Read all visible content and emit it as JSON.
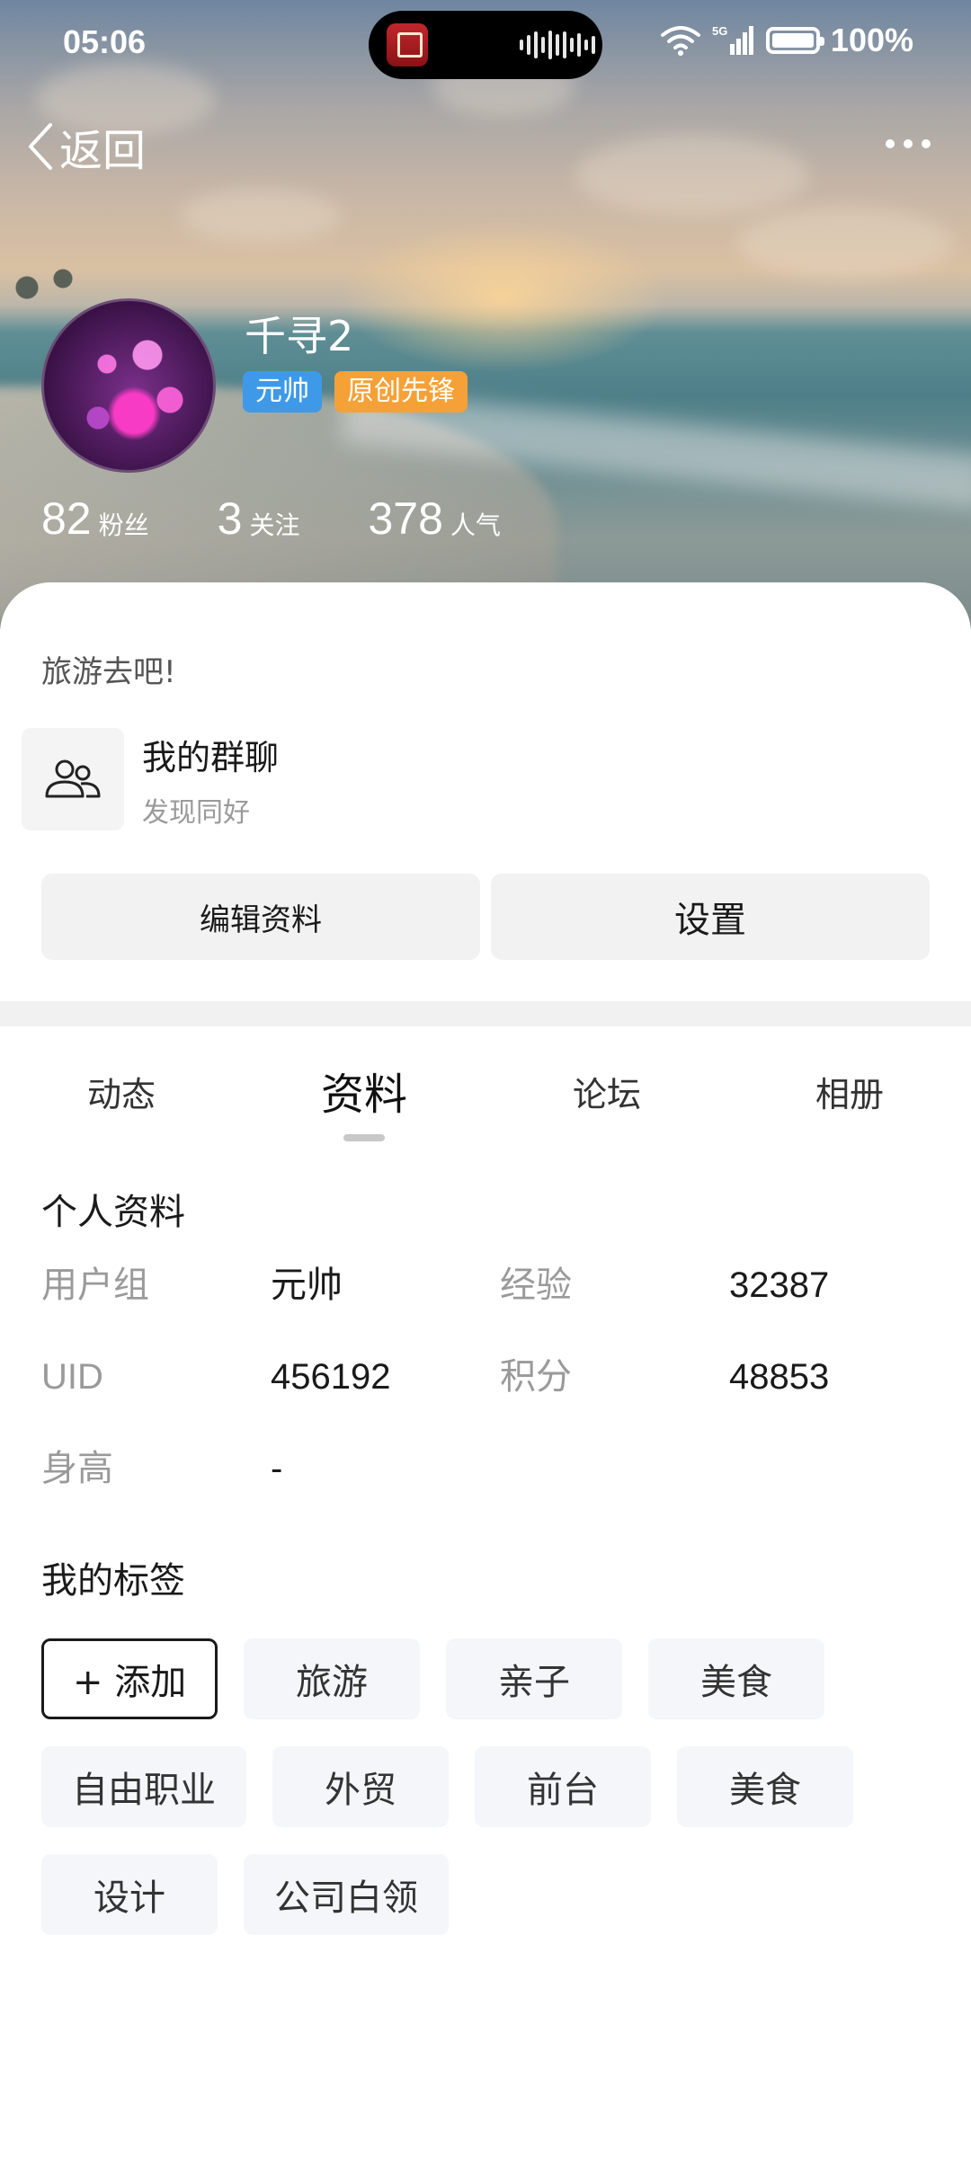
{
  "status_bar": {
    "time": "05:06",
    "network_type": "5G",
    "battery": "100%",
    "icons": [
      "wifi-icon",
      "signal-icon",
      "battery-icon"
    ]
  },
  "nav": {
    "back_label": "返回",
    "more_icon": "more-dots-icon"
  },
  "profile": {
    "username": "千寻2",
    "badges": [
      {
        "label": "元帅",
        "color": "#3e9ae8"
      },
      {
        "label": "原创先锋",
        "color": "#f5a138"
      }
    ],
    "stats": [
      {
        "value": "82",
        "label": "粉丝"
      },
      {
        "value": "3",
        "label": "关注"
      },
      {
        "value": "378",
        "label": "人气"
      }
    ],
    "bio": "旅游去吧!"
  },
  "group_chat": {
    "title": "我的群聊",
    "subtitle": "发现同好",
    "icon": "group-people-icon"
  },
  "actions": {
    "edit_label": "编辑资料",
    "settings_label": "设置"
  },
  "tabs": [
    {
      "label": "动态",
      "active": false
    },
    {
      "label": "资料",
      "active": true
    },
    {
      "label": "论坛",
      "active": false
    },
    {
      "label": "相册",
      "active": false
    }
  ],
  "personal_info": {
    "title": "个人资料",
    "rows": [
      {
        "label1": "用户组",
        "value1": "元帅",
        "label2": "经验",
        "value2": "32387"
      },
      {
        "label1": "UID",
        "value1": "456192",
        "label2": "积分",
        "value2": "48853"
      },
      {
        "label1": "身高",
        "value1": "-"
      }
    ]
  },
  "my_tags": {
    "title": "我的标签",
    "add_label": "+ 添加",
    "items": [
      "旅游",
      "亲子",
      "美食",
      "自由职业",
      "外贸",
      "前台",
      "美食",
      "设计",
      "公司白领"
    ]
  },
  "colors": {
    "badge_blue": "#3e9ae8",
    "badge_orange": "#f5a138",
    "tag_bg": "#f4f6fa",
    "button_bg": "#f2f2f2"
  }
}
